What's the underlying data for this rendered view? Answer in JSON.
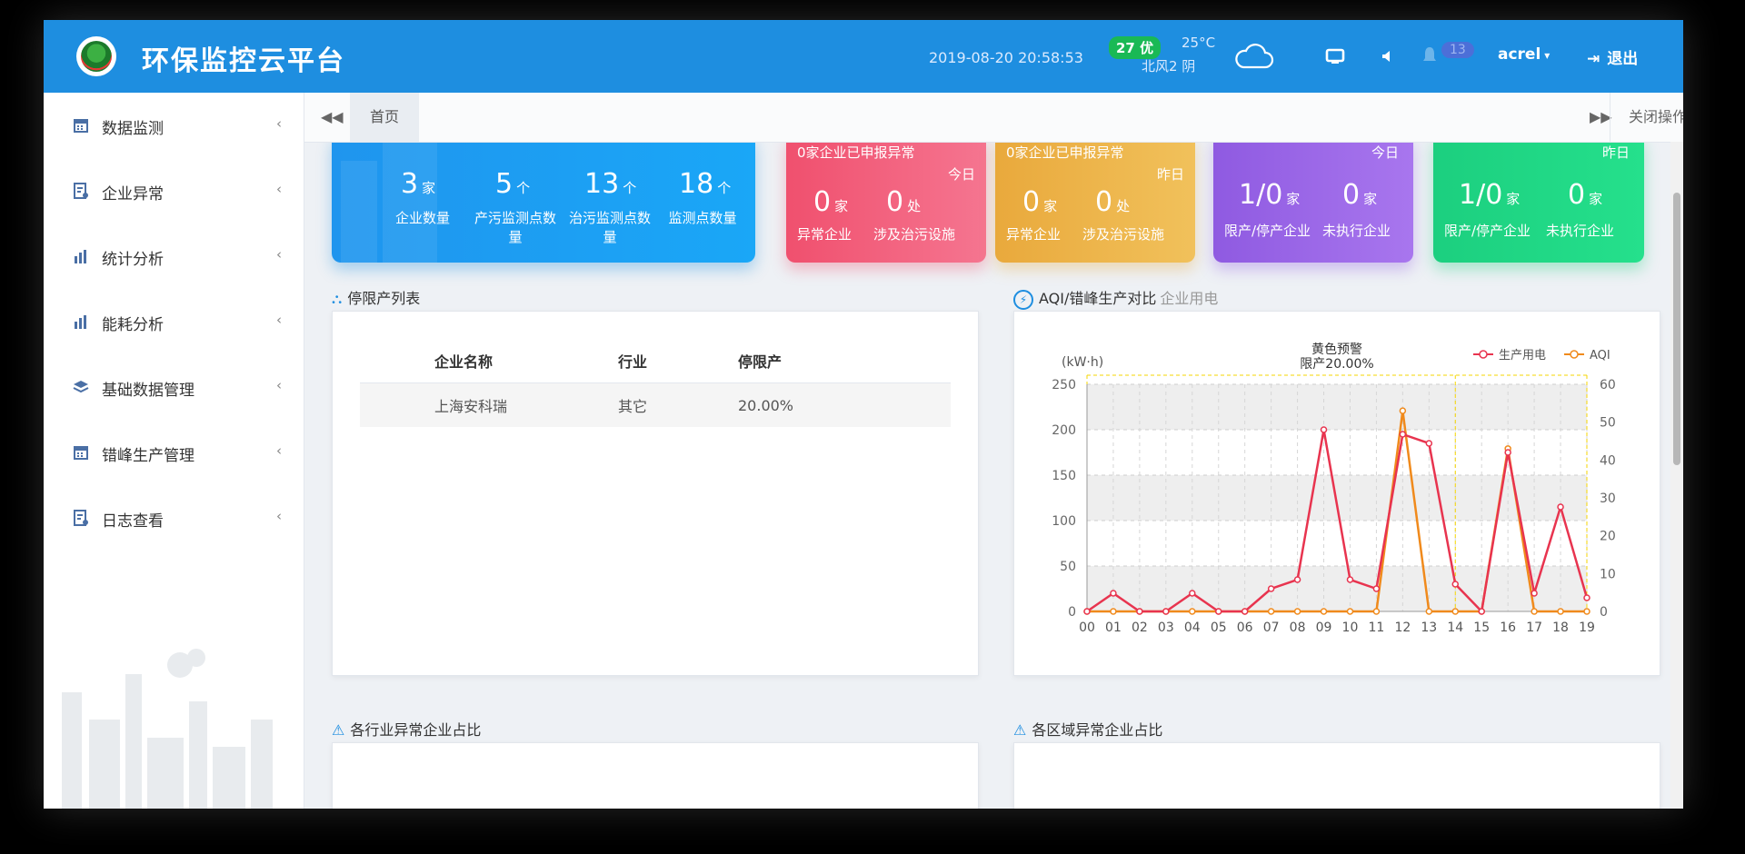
{
  "header": {
    "title": "环保监控云平台",
    "datetime": "2019-08-20  20:58:53",
    "aqi_badge": "27 优",
    "temperature": "25°C",
    "wind_weather": "北风2  阴",
    "notification_count": "13",
    "user": "acrel",
    "logout_label": "退出",
    "icons": [
      "logo",
      "cloud-icon",
      "screen-icon",
      "sound-icon",
      "bell-icon",
      "logout-icon"
    ]
  },
  "sidebar": {
    "items": [
      {
        "label": "数据监测",
        "icon": "calendar-icon"
      },
      {
        "label": "企业异常",
        "icon": "report-icon"
      },
      {
        "label": "统计分析",
        "icon": "bar-chart-icon"
      },
      {
        "label": "能耗分析",
        "icon": "bar-chart-icon"
      },
      {
        "label": "基础数据管理",
        "icon": "layers-icon"
      },
      {
        "label": "错峰生产管理",
        "icon": "calendar-icon"
      },
      {
        "label": "日志查看",
        "icon": "report-icon"
      }
    ]
  },
  "tabs": {
    "home": "首页",
    "close_ops": "关闭操作"
  },
  "summary_card": {
    "items": [
      {
        "value": "3",
        "unit": "家",
        "label": "企业数量"
      },
      {
        "value": "5",
        "unit": "个",
        "label": "产污监测点数量"
      },
      {
        "value": "13",
        "unit": "个",
        "label": "治污监测点数量"
      },
      {
        "value": "18",
        "unit": "个",
        "label": "监测点数量"
      }
    ]
  },
  "anomaly_today": {
    "header": "0家企业已申报异常",
    "period": "今日",
    "v1": "0",
    "u1": "家",
    "l1": "异常企业",
    "v2": "0",
    "u2": "处",
    "l2": "涉及治污设施"
  },
  "anomaly_yesterday": {
    "header": "0家企业已申报异常",
    "period": "昨日",
    "v1": "0",
    "u1": "家",
    "l1": "异常企业",
    "v2": "0",
    "u2": "处",
    "l2": "涉及治污设施"
  },
  "restrict_today": {
    "period": "今日",
    "v1": "1/0",
    "u1": "家",
    "l1": "限产/停产企业",
    "v2": "0",
    "u2": "家",
    "l2": "未执行企业"
  },
  "restrict_yesterday": {
    "period": "昨日",
    "v1": "1/0",
    "u1": "家",
    "l1": "限产/停产企业",
    "v2": "0",
    "u2": "家",
    "l2": "未执行企业"
  },
  "shutdown_list": {
    "title": "停限产列表",
    "columns": [
      "企业名称",
      "行业",
      "停限产"
    ],
    "rows": [
      [
        "上海安科瑞",
        "其它",
        "20.00%"
      ]
    ]
  },
  "aqi_section": {
    "title": "AQI/错峰生产对比",
    "subtitle": "企业用电"
  },
  "industry_section": {
    "title": "各行业异常企业占比"
  },
  "region_section": {
    "title": "各区域异常企业占比"
  },
  "chart_data": {
    "type": "line",
    "title": "黄色预警",
    "subtitle": "限产20.00%",
    "ylabel": "(kW·h)",
    "categories": [
      "00",
      "01",
      "02",
      "03",
      "04",
      "05",
      "06",
      "07",
      "08",
      "09",
      "10",
      "11",
      "12",
      "13",
      "14",
      "15",
      "16",
      "17",
      "18",
      "19"
    ],
    "ylim": [
      0,
      250
    ],
    "y2lim": [
      0,
      60
    ],
    "yticks": [
      0,
      50,
      100,
      150,
      200,
      250
    ],
    "y2ticks": [
      0,
      10,
      20,
      30,
      40,
      50,
      60
    ],
    "legend_position": "top-right",
    "grid": true,
    "series": [
      {
        "name": "生产用电",
        "color": "#e8344f",
        "axis": "left",
        "values": [
          0,
          20,
          0,
          0,
          20,
          0,
          0,
          25,
          35,
          200,
          35,
          25,
          195,
          185,
          30,
          0,
          175,
          20,
          115,
          15
        ]
      },
      {
        "name": "AQI",
        "color": "#f08a1c",
        "axis": "right",
        "values": [
          0,
          0,
          0,
          0,
          0,
          0,
          0,
          0,
          0,
          0,
          0,
          0,
          53,
          0,
          0,
          0,
          43,
          0,
          0,
          0
        ]
      }
    ]
  }
}
